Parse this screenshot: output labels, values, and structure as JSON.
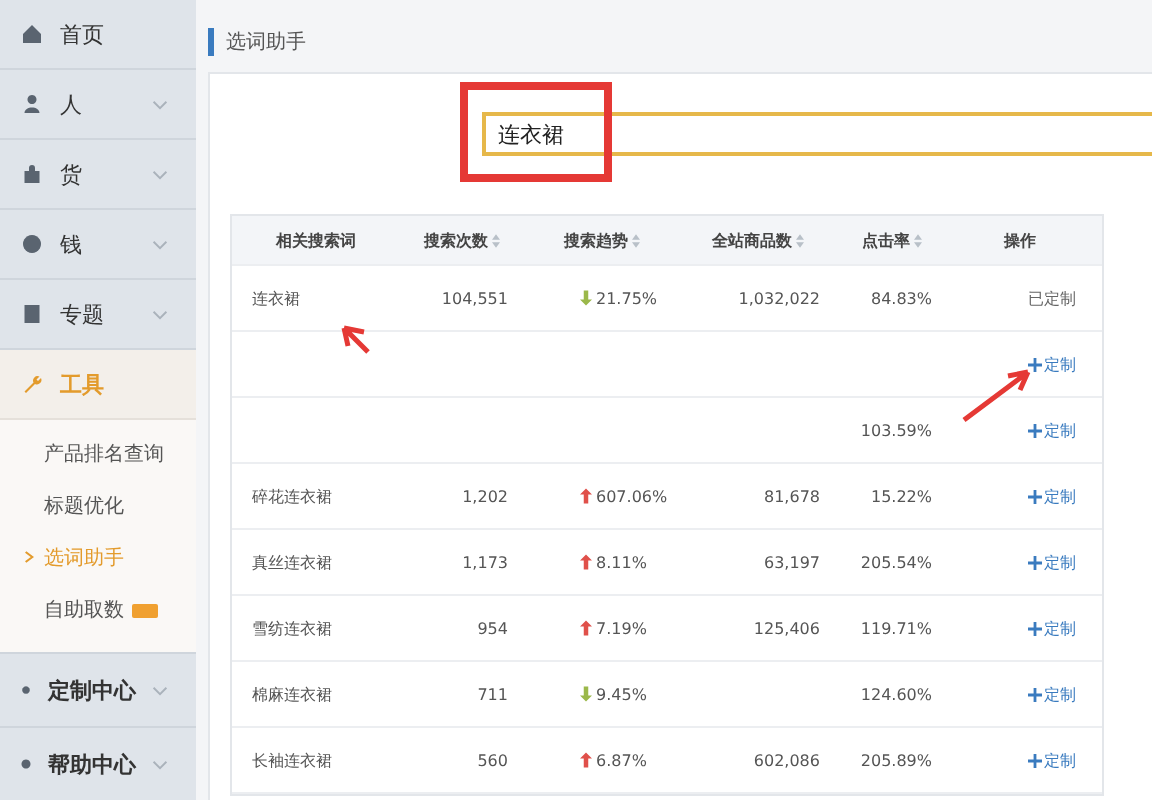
{
  "sidebar": {
    "items": [
      {
        "label": "首页",
        "expandable": false,
        "expanded": false
      },
      {
        "label": "人",
        "expandable": true,
        "expanded": false
      },
      {
        "label": "货",
        "expandable": true,
        "expanded": false
      },
      {
        "label": "钱",
        "expandable": true,
        "expanded": false
      },
      {
        "label": "专题",
        "expandable": true,
        "expanded": false
      },
      {
        "label": "工具",
        "expandable": false,
        "expanded": true,
        "children": [
          {
            "label": "产品排名查询",
            "selected": false,
            "new": false
          },
          {
            "label": "标题优化",
            "selected": false,
            "new": false
          },
          {
            "label": "选词助手",
            "selected": true,
            "new": false
          },
          {
            "label": "自助取数",
            "selected": false,
            "new": true
          }
        ]
      }
    ],
    "bottom_items": [
      {
        "label": "定制中心"
      },
      {
        "label": "帮助中心"
      }
    ]
  },
  "page_title": "选词助手",
  "search": {
    "value": "连衣裙"
  },
  "table": {
    "columns": [
      {
        "label": "相关搜索词",
        "sortable": false
      },
      {
        "label": "搜索次数",
        "sortable": true
      },
      {
        "label": "搜索趋势",
        "sortable": true
      },
      {
        "label": "全站商品数",
        "sortable": true
      },
      {
        "label": "点击率",
        "sortable": true
      },
      {
        "label": "操作",
        "sortable": false
      }
    ],
    "rows": [
      {
        "keyword": "连衣裙",
        "searches": "104,551",
        "kind": "down",
        "trend_value": "21.75%",
        "goods": "1,032,022",
        "ctr": "84.83%",
        "action": "已定制",
        "customized": true
      },
      {
        "keyword": "",
        "searches": "",
        "trend_value": "",
        "goods": "",
        "ctr": "",
        "action": "定制",
        "customized": false
      },
      {
        "keyword": "",
        "searches": "",
        "trend_value": "",
        "goods": "",
        "ctr": "103.59%",
        "action": "定制",
        "customized": false
      },
      {
        "keyword": "碎花连衣裙",
        "searches": "1,202",
        "kind": "up",
        "trend_value": "607.06%",
        "goods": "81,678",
        "ctr": "15.22%",
        "action": "定制",
        "customized": false
      },
      {
        "keyword": "真丝连衣裙",
        "searches": "1,173",
        "kind": "up",
        "trend_value": "8.11%",
        "goods": "63,197",
        "ctr": "205.54%",
        "action": "定制",
        "customized": false
      },
      {
        "keyword": "雪纺连衣裙",
        "searches": "954",
        "kind": "up",
        "trend_value": "7.19%",
        "goods": "125,406",
        "ctr": "119.71%",
        "action": "定制",
        "customized": false
      },
      {
        "keyword": "棉麻连衣裙",
        "searches": "711",
        "kind": "down",
        "trend_value": "9.45%",
        "goods": "",
        "ctr": "124.60%",
        "action": "定制",
        "customized": false
      },
      {
        "keyword": "长袖连衣裙",
        "searches": "560",
        "kind": "up",
        "trend_value": "6.87%",
        "goods": "602,086",
        "ctr": "205.89%",
        "action": "定制",
        "customized": false
      }
    ]
  }
}
